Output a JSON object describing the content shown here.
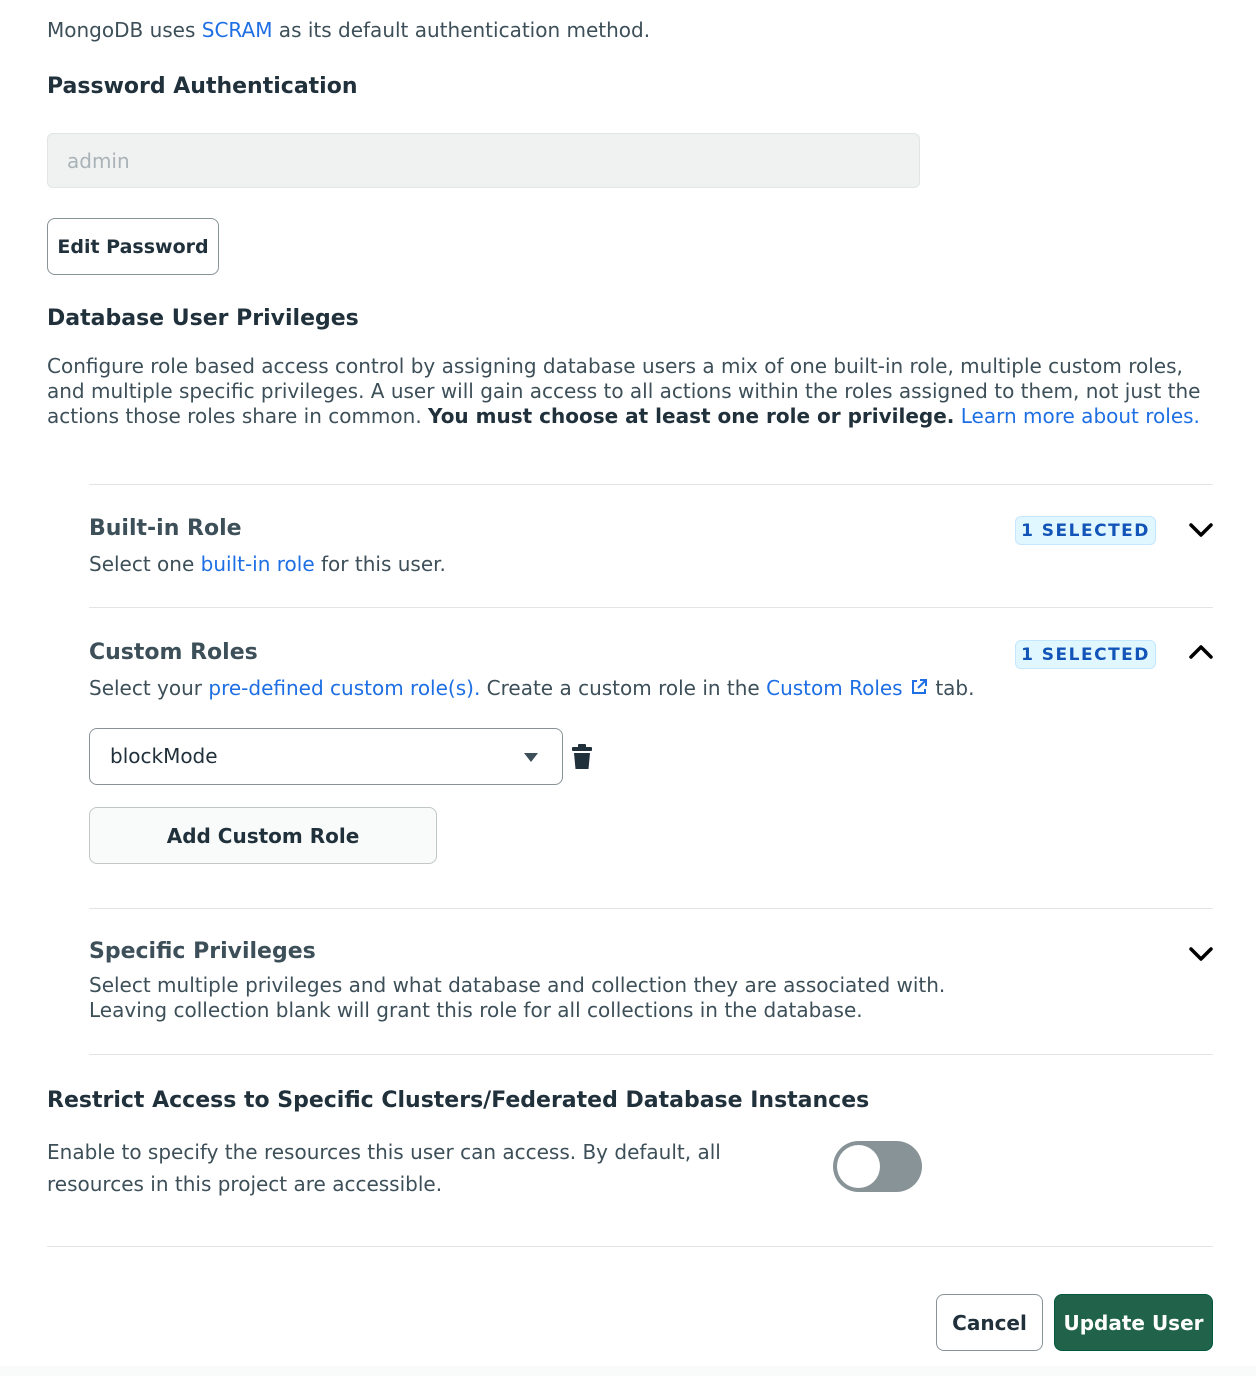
{
  "intro": {
    "before": "MongoDB uses ",
    "link": "SCRAM",
    "after": " as its default authentication method."
  },
  "password_auth": {
    "heading": "Password Authentication",
    "username_value": "admin",
    "edit_password_label": "Edit Password"
  },
  "privileges": {
    "heading": "Database User Privileges",
    "desc_text": "Configure role based access control by assigning database users a mix of one built-in role, multiple custom roles, and multiple specific privileges. A user will gain access to all actions within the roles assigned to them, not just the actions those roles share in common. ",
    "desc_bold": "You must choose at least one role or privilege.",
    "desc_link": "Learn more about roles."
  },
  "builtin_role": {
    "title": "Built-in Role",
    "badge": "1 SELECTED",
    "desc_before": "Select one ",
    "desc_link": "built-in role",
    "desc_after": " for this user."
  },
  "custom_roles": {
    "title": "Custom Roles",
    "badge": "1 SELECTED",
    "desc_before": "Select your ",
    "desc_link1": "pre-defined custom role(s).",
    "desc_middle": " Create a custom role in the ",
    "desc_link2": "Custom Roles",
    "desc_after": " tab.",
    "selected_role": "blockMode",
    "add_label": "Add Custom Role"
  },
  "specific_privileges": {
    "title": "Specific Privileges",
    "desc_line1": "Select multiple privileges and what database and collection they are associated with.",
    "desc_line2": "Leaving collection blank will grant this role for all collections in the database."
  },
  "restrict_access": {
    "heading": "Restrict Access to Specific Clusters/Federated Database Instances",
    "desc": "Enable to specify the resources this user can access. By default, all resources in this project are accessible.",
    "toggle_on": false
  },
  "footer": {
    "cancel_label": "Cancel",
    "update_label": "Update User"
  },
  "colors": {
    "link": "#1e6fe4",
    "primary_button": "#21634a",
    "badge_bg": "#e1f7ff",
    "badge_text": "#1254b7",
    "toggle_off": "#889397"
  }
}
